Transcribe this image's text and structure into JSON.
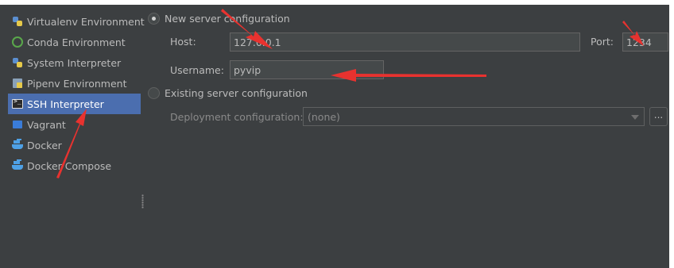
{
  "sidebar": {
    "items": [
      {
        "label": "Virtualenv Environment",
        "icon": "python-icon"
      },
      {
        "label": "Conda Environment",
        "icon": "conda-icon"
      },
      {
        "label": "System Interpreter",
        "icon": "python-icon"
      },
      {
        "label": "Pipenv Environment",
        "icon": "pipenv-icon"
      },
      {
        "label": "SSH Interpreter",
        "icon": "ssh-terminal-icon",
        "selected": true
      },
      {
        "label": "Vagrant",
        "icon": "vagrant-icon"
      },
      {
        "label": "Docker",
        "icon": "docker-icon"
      },
      {
        "label": "Docker Compose",
        "icon": "docker-icon"
      }
    ]
  },
  "form": {
    "new_server_label": "New server configuration",
    "host_label": "Host:",
    "host_value": "127.0.0.1",
    "port_label": "Port:",
    "port_value": "1234",
    "username_label": "Username:",
    "username_value": "pyvip",
    "existing_server_label": "Existing server configuration",
    "deployment_label": "Deployment configuration:",
    "deployment_value": "(none)",
    "browse_label": "..."
  },
  "colors": {
    "background": "#3c3f41",
    "selection": "#4b6eaf",
    "annotation_arrow": "#e8322f"
  }
}
